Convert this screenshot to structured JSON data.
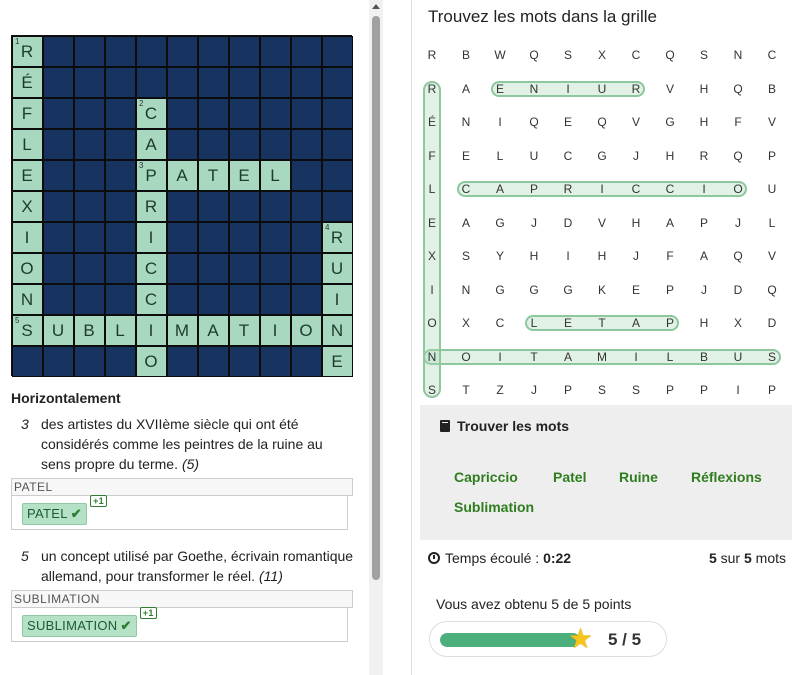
{
  "crossword": {
    "size": 11,
    "words": [
      {
        "num": "1",
        "dir": "down",
        "row": 0,
        "col": 0,
        "text": "RÉFLEXIONS"
      },
      {
        "num": "2",
        "dir": "down",
        "row": 2,
        "col": 4,
        "text": "CAPRICCIO"
      },
      {
        "num": "3",
        "dir": "across",
        "row": 4,
        "col": 4,
        "text": "PATEL"
      },
      {
        "num": "4",
        "dir": "down",
        "row": 6,
        "col": 10,
        "text": "RUINE"
      },
      {
        "num": "5",
        "dir": "across",
        "row": 9,
        "col": 0,
        "text": "SUBLIMATION"
      }
    ]
  },
  "clues": {
    "title": "Horizontalement",
    "items": [
      {
        "num": "3",
        "text": "des artistes du XVIIème siècle qui ont été considérés comme les peintres de la ruine au sens propre du terme.",
        "length": "(5)",
        "label": "PATEL",
        "answer": "PATEL",
        "bonus": "+1"
      },
      {
        "num": "5",
        "text": "un concept utilisé par Goethe, écrivain romantique allemand, pour transformer le réel.",
        "length": "(11)",
        "label": "SUBLIMATION",
        "answer": "SUBLIMATION",
        "bonus": "+1"
      }
    ]
  },
  "wordsearch": {
    "title": "Trouvez les mots dans la grille",
    "rows": [
      "RBWQSXCQSNC",
      "RAENIURVHQB",
      "ÉNIQEQVGHFV",
      "FELUCGJHRQP",
      "LCAPRICCIOU",
      "EAGJDVHAPJL",
      "XSYHIHJFAQV",
      "INGGGKEPJDQ",
      "OXCLETAPHXD",
      "NOITAMILBUS",
      "STZJPSSPPIP"
    ],
    "highlights": [
      {
        "r1": 1,
        "c1": 2,
        "r2": 1,
        "c2": 6,
        "word": "ENIUR"
      },
      {
        "r1": 4,
        "c1": 1,
        "r2": 4,
        "c2": 9,
        "word": "CAPRICCIO"
      },
      {
        "r1": 8,
        "c1": 3,
        "r2": 8,
        "c2": 7,
        "word": "LETAP"
      },
      {
        "r1": 9,
        "c1": 0,
        "r2": 9,
        "c2": 10,
        "word": "NOITAMILBUS"
      },
      {
        "r1": 1,
        "c1": 0,
        "r2": 10,
        "c2": 0,
        "word": "RÉFLEXIONS"
      }
    ]
  },
  "find_panel": {
    "title": "Trouver les mots",
    "words": [
      "Capriccio",
      "Patel",
      "Ruine",
      "Réflexions",
      "Sublimation"
    ]
  },
  "status": {
    "timer_label": "Temps écoulé :",
    "timer_value": "0:22",
    "found": "5",
    "sur": "sur",
    "total": "5",
    "mots": "mots",
    "score_text": "Vous avez obtenu 5 de 5 points",
    "score_display": "5 / 5",
    "score_fraction": 1.0
  },
  "colors": {
    "crossword_dark": "#173460",
    "crossword_letter_bg": "#a8d8c0",
    "found_word": "#2f7d1f",
    "highlight": "#8cc79e"
  }
}
